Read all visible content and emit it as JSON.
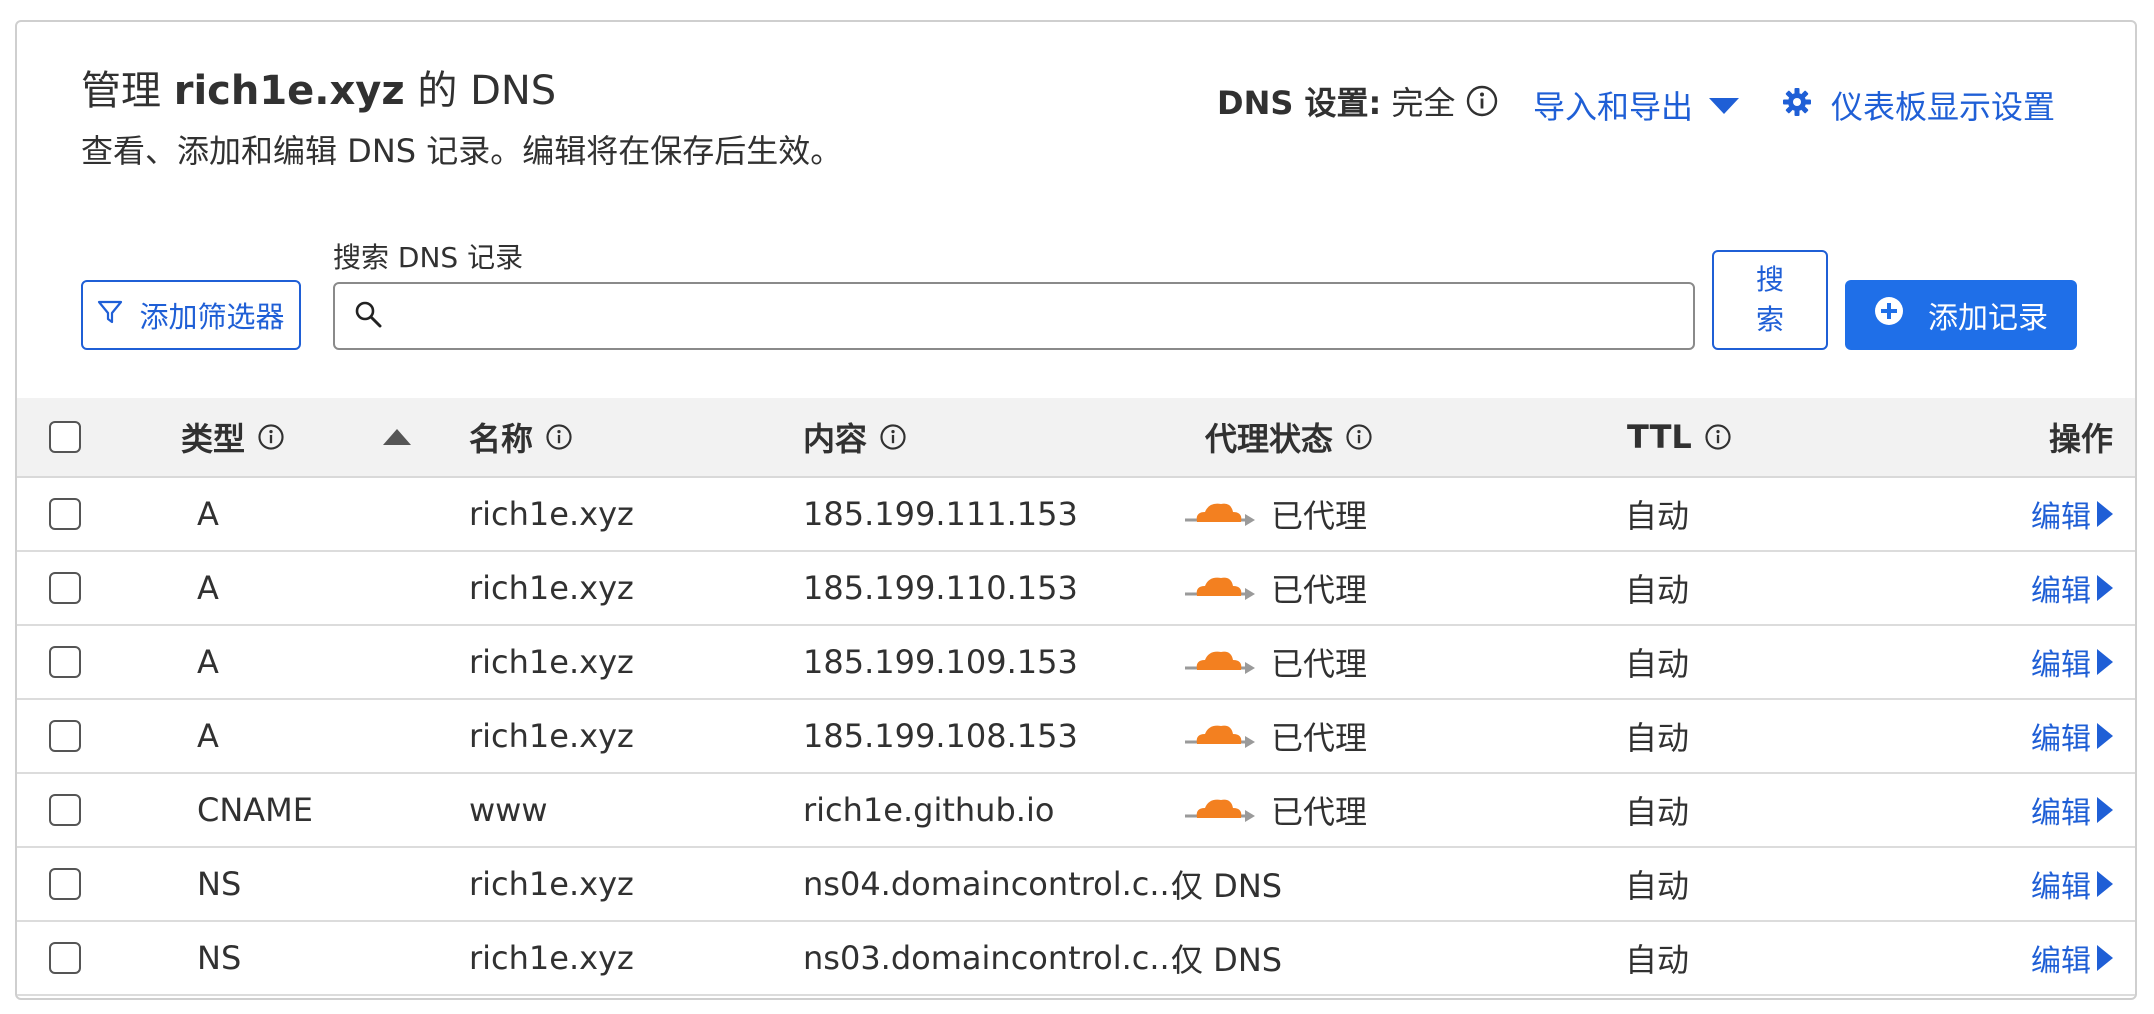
{
  "header": {
    "title_prefix": "管理",
    "title_domain": "rich1e.xyz",
    "title_suffix": "的 DNS",
    "subtitle": "查看、添加和编辑 DNS 记录。编辑将在保存后生效。",
    "dns_setting_label": "DNS 设置:",
    "dns_setting_value": "完全",
    "import_export": "导入和导出",
    "dashboard_settings": "仪表板显示设置"
  },
  "toolbar": {
    "filter_button": "添加筛选器",
    "search_label": "搜索 DNS 记录",
    "search_value": "",
    "search_button": "搜索",
    "add_record_button": "添加记录"
  },
  "table": {
    "headers": {
      "type": "类型",
      "name": "名称",
      "content": "内容",
      "proxy": "代理状态",
      "ttl": "TTL",
      "actions": "操作"
    },
    "edit_label": "编辑",
    "rows": [
      {
        "type": "A",
        "name": "rich1e.xyz",
        "content": "185.199.111.153",
        "proxy": "已代理",
        "proxied": true,
        "ttl": "自动"
      },
      {
        "type": "A",
        "name": "rich1e.xyz",
        "content": "185.199.110.153",
        "proxy": "已代理",
        "proxied": true,
        "ttl": "自动"
      },
      {
        "type": "A",
        "name": "rich1e.xyz",
        "content": "185.199.109.153",
        "proxy": "已代理",
        "proxied": true,
        "ttl": "自动"
      },
      {
        "type": "A",
        "name": "rich1e.xyz",
        "content": "185.199.108.153",
        "proxy": "已代理",
        "proxied": true,
        "ttl": "自动"
      },
      {
        "type": "CNAME",
        "name": "www",
        "content": "rich1e.github.io",
        "proxy": "已代理",
        "proxied": true,
        "ttl": "自动"
      },
      {
        "type": "NS",
        "name": "rich1e.xyz",
        "content": "ns04.domaincontrol.c...",
        "proxy": "仅 DNS",
        "proxied": false,
        "ttl": "自动"
      },
      {
        "type": "NS",
        "name": "rich1e.xyz",
        "content": "ns03.domaincontrol.c...",
        "proxy": "仅 DNS",
        "proxied": false,
        "ttl": "自动"
      }
    ]
  },
  "icons": {
    "info": "info-icon",
    "caret": "caret-down-icon",
    "gear": "gear-icon",
    "filter": "filter-icon",
    "search": "search-icon",
    "plus": "plus-circle-icon",
    "sort": "sort-up-icon",
    "cloud": "proxied-cloud-icon",
    "edit_arrow": "caret-right-icon"
  },
  "colors": {
    "accent": "#1f5fd6",
    "primary_button": "#1f6fe8",
    "cloud": "#f38020",
    "header_bg": "#f2f2f2"
  }
}
